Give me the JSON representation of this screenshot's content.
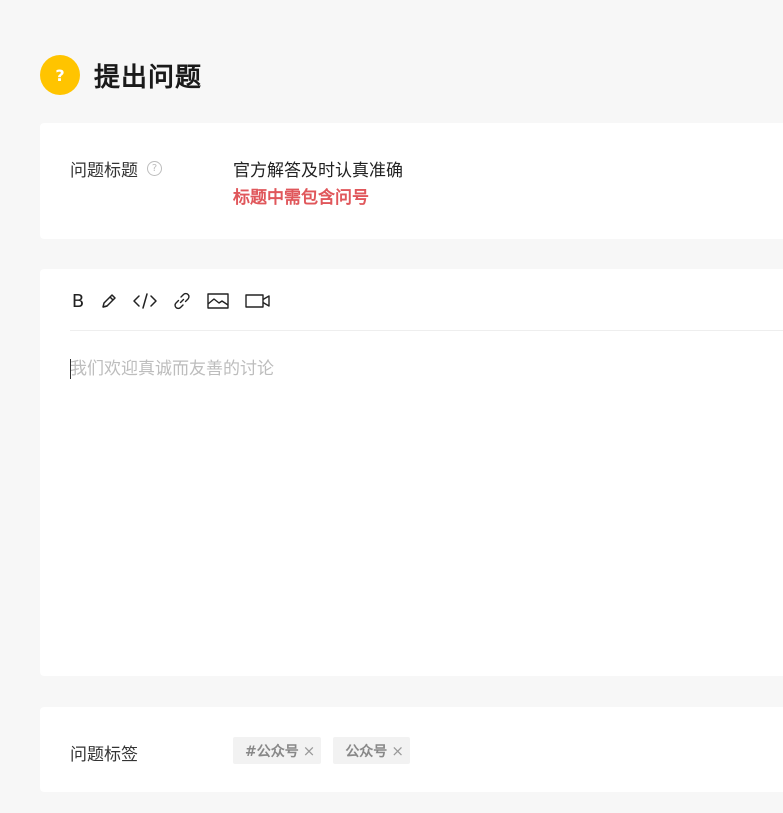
{
  "header": {
    "badge": "?",
    "title": "提出问题"
  },
  "question_title": {
    "label": "问题标题",
    "help_icon": "?",
    "value": "官方解答及时认真准确",
    "hint": "标题中需包含问号",
    "hint_color": "#e0575b"
  },
  "editor": {
    "toolbar": [
      {
        "name": "bold",
        "label": "B"
      },
      {
        "name": "highlight",
        "icon": "pen-icon"
      },
      {
        "name": "code",
        "icon": "code-icon"
      },
      {
        "name": "link",
        "icon": "link-icon"
      },
      {
        "name": "image",
        "icon": "image-icon"
      },
      {
        "name": "video",
        "icon": "video-icon"
      }
    ],
    "placeholder": "我们欢迎真诚而友善的讨论",
    "value": ""
  },
  "tags_section": {
    "label": "问题标签",
    "tags": [
      {
        "text": "#公众号",
        "remove": "×"
      },
      {
        "text": "公众号",
        "remove": "×"
      }
    ]
  },
  "colors": {
    "accent": "#ffc400",
    "background": "#f7f7f7",
    "card": "#ffffff"
  }
}
